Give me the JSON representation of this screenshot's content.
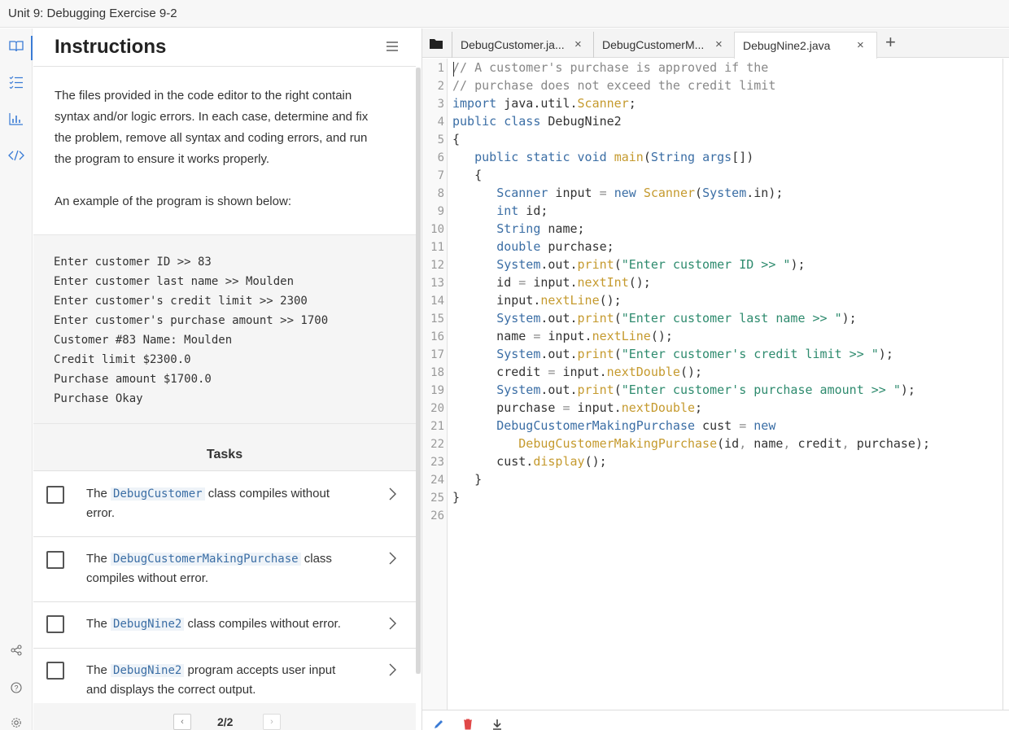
{
  "window": {
    "title": "Unit 9: Debugging Exercise 9-2"
  },
  "rail": {
    "icons": [
      "book-icon",
      "checklist-icon",
      "chart-icon",
      "code-icon",
      "share-icon",
      "help-icon",
      "settings-icon"
    ]
  },
  "instructions": {
    "heading": "Instructions",
    "para1_lines": [
      "The files provided in the code editor to the right contain",
      "syntax and/or logic errors. In each case, determine and fix",
      "the problem, remove all syntax and coding errors, and run",
      "the program to ensure it works properly."
    ],
    "para2": "An example of the program is shown below:",
    "example_lines": [
      "Enter customer ID >> 83",
      "Enter customer last name >> Moulden",
      "Enter customer's credit limit >> 2300",
      "Enter customer's purchase amount >> 1700",
      "Customer #83 Name: Moulden",
      "Credit limit $2300.0",
      "Purchase amount $1700.0",
      "Purchase Okay"
    ]
  },
  "tasks": {
    "title": "Tasks",
    "items": [
      {
        "pre": "The ",
        "code": "DebugCustomer",
        "post": " class compiles without",
        "line2": "error."
      },
      {
        "pre": "The ",
        "code": "DebugCustomerMakingPurchase",
        "post": " class",
        "line2": "compiles without error."
      },
      {
        "pre": "The ",
        "code": "DebugNine2",
        "post": " class compiles without error.",
        "line2": ""
      },
      {
        "pre": "The ",
        "code": "DebugNine2",
        "post": " program accepts user input",
        "line2": "and displays the correct output."
      }
    ]
  },
  "pager": {
    "prev": "‹",
    "next": "›",
    "page": "2/2"
  },
  "editor": {
    "tabs": [
      {
        "label": "DebugCustomer.ja...",
        "close": "×"
      },
      {
        "label": "DebugCustomerM...",
        "close": "×"
      },
      {
        "label": "DebugNine2.java",
        "close": "×"
      }
    ],
    "add_tab": "+",
    "line_numbers": [
      "1",
      "2",
      "3",
      "4",
      "5",
      "6",
      "7",
      "8",
      "9",
      "10",
      "11",
      "12",
      "13",
      "14",
      "15",
      "16",
      "17",
      "18",
      "19",
      "20",
      "21",
      "22",
      "23",
      "24",
      "25",
      "26"
    ],
    "code_lines": [
      "// A customer's purchase is approved if the",
      "// purchase does not exceed the credit limit",
      "import java.util.Scanner;",
      "public class DebugNine2",
      "{",
      "   public static void main(String args[])",
      "   {",
      "      Scanner input = new Scanner(System.in);",
      "      int id;",
      "      String name;",
      "      double purchase;",
      "      System.out.print(\"Enter customer ID >> \");",
      "      id = input.nextInt();",
      "      input.nextLine();",
      "      System.out.print(\"Enter customer last name >> \");",
      "      name = input.nextLine();",
      "      System.out.print(\"Enter customer's credit limit >> \");",
      "      credit = input.nextDouble();",
      "      System.out.print(\"Enter customer's purchase amount >> \");",
      "      purchase = input.nextDouble;",
      "      DebugCustomerMakingPurchase cust = new",
      "         DebugCustomerMakingPurchase(id, name, credit, purchase);",
      "      cust.display();",
      "   }",
      "}",
      ""
    ]
  },
  "colors": {
    "keyword": "#3b6ea5",
    "comment": "#888888",
    "method": "#c59a2e",
    "string": "#2e8b6e",
    "accent": "#3a7bd5",
    "delete": "#e04848"
  }
}
